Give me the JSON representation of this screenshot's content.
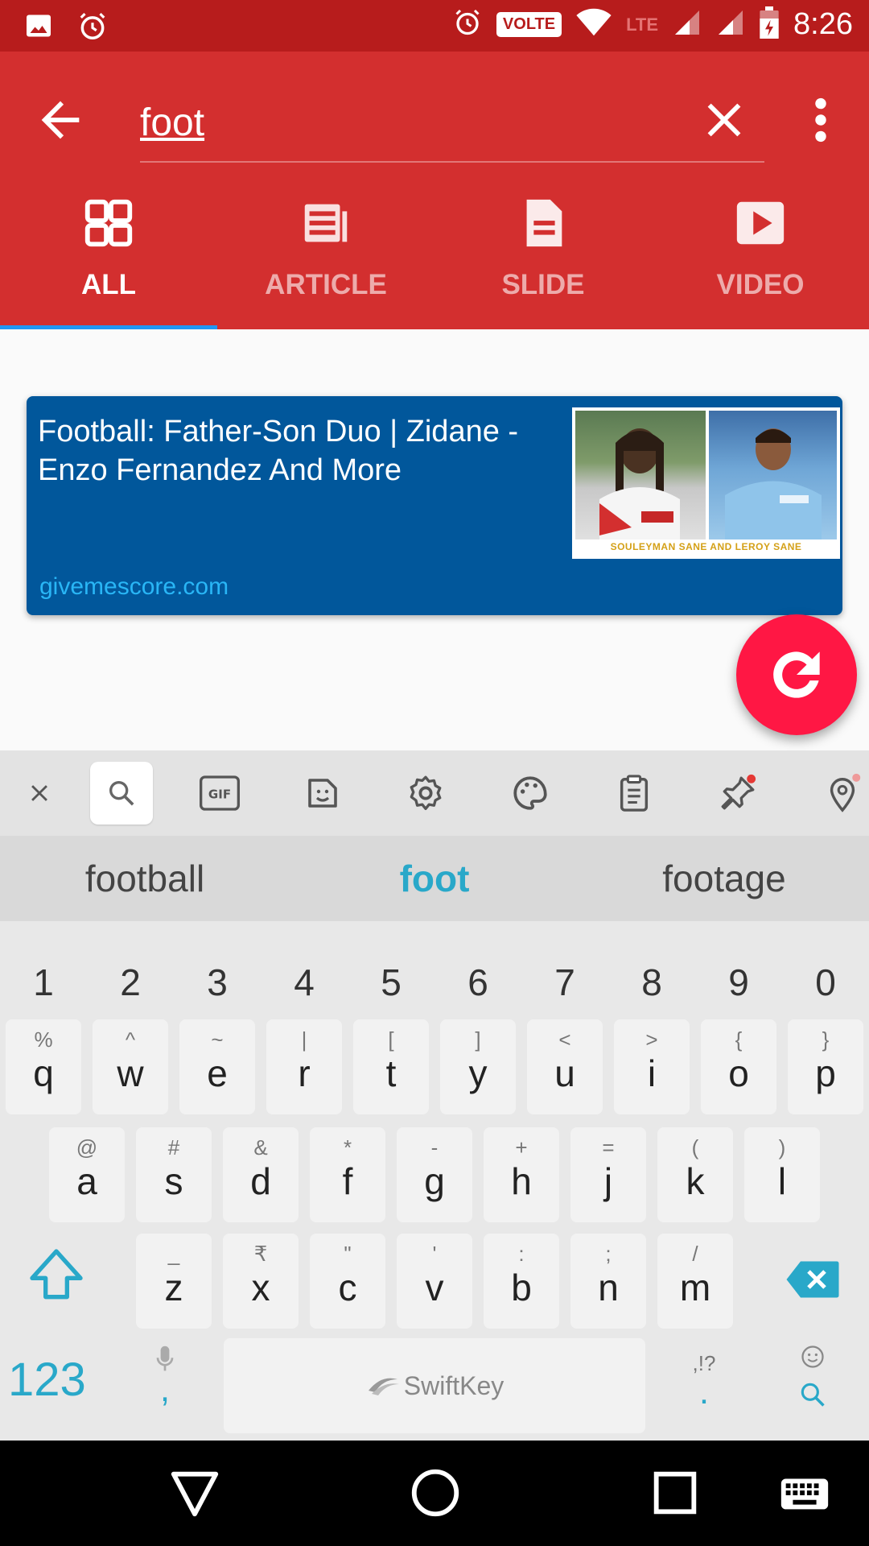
{
  "status_bar": {
    "time": "8:26",
    "volte": "VOLTE",
    "network": "LTE",
    "icons": [
      "image-icon",
      "alarm-icon",
      "alarm-icon",
      "wifi-icon",
      "signal-icon",
      "signal-icon",
      "battery-icon"
    ]
  },
  "toolbar": {
    "search_value": "foot",
    "icons": {
      "back": "arrow-left-icon",
      "clear": "close-icon",
      "more": "more-vert-icon"
    }
  },
  "tabs": [
    {
      "label": "ALL",
      "icon": "grid-icon",
      "active": true
    },
    {
      "label": "ARTICLE",
      "icon": "article-icon",
      "active": false
    },
    {
      "label": "SLIDE",
      "icon": "document-icon",
      "active": false
    },
    {
      "label": "VIDEO",
      "icon": "play-icon",
      "active": false
    }
  ],
  "results": [
    {
      "title": "Football: Father-Son Duo | Zidane - Enzo Fernandez And More",
      "source": "givemescore.com",
      "thumbnail_caption": "SOULEYMAN SANE AND LEROY SANE"
    }
  ],
  "fab": {
    "icon": "refresh-icon"
  },
  "keyboard": {
    "toolbar_icons": [
      "close-icon",
      "search-icon",
      "gif-icon",
      "sticker-icon",
      "settings-icon",
      "palette-icon",
      "clipboard-icon",
      "pin-icon",
      "location-icon"
    ],
    "suggestions": [
      "football",
      "foot",
      "footage"
    ],
    "numbers": [
      "1",
      "2",
      "3",
      "4",
      "5",
      "6",
      "7",
      "8",
      "9",
      "0"
    ],
    "row1": [
      {
        "main": "q",
        "sub": "%"
      },
      {
        "main": "w",
        "sub": "^"
      },
      {
        "main": "e",
        "sub": "~"
      },
      {
        "main": "r",
        "sub": "|"
      },
      {
        "main": "t",
        "sub": "["
      },
      {
        "main": "y",
        "sub": "]"
      },
      {
        "main": "u",
        "sub": "<"
      },
      {
        "main": "i",
        "sub": ">"
      },
      {
        "main": "o",
        "sub": "{"
      },
      {
        "main": "p",
        "sub": "}"
      }
    ],
    "row2": [
      {
        "main": "a",
        "sub": "@"
      },
      {
        "main": "s",
        "sub": "#"
      },
      {
        "main": "d",
        "sub": "&"
      },
      {
        "main": "f",
        "sub": "*"
      },
      {
        "main": "g",
        "sub": "-"
      },
      {
        "main": "h",
        "sub": "+"
      },
      {
        "main": "j",
        "sub": "="
      },
      {
        "main": "k",
        "sub": "("
      },
      {
        "main": "l",
        "sub": ")"
      }
    ],
    "row3": [
      {
        "main": "z",
        "sub": "_"
      },
      {
        "main": "x",
        "sub": "₹"
      },
      {
        "main": "c",
        "sub": "\""
      },
      {
        "main": "v",
        "sub": "'"
      },
      {
        "main": "b",
        "sub": ":"
      },
      {
        "main": "n",
        "sub": ";"
      },
      {
        "main": "m",
        "sub": "/"
      }
    ],
    "key_123": "123",
    "mic_comma": ",",
    "space_brand": "SwiftKey",
    "punct_hint": ",!?",
    "period": "."
  },
  "colors": {
    "accent": "#d32f2f",
    "status_bar": "#b71c1c",
    "card_bg": "#01579b",
    "link": "#29b6f6",
    "fab": "#ff1744",
    "keyboard_accent": "#29a8c9"
  }
}
